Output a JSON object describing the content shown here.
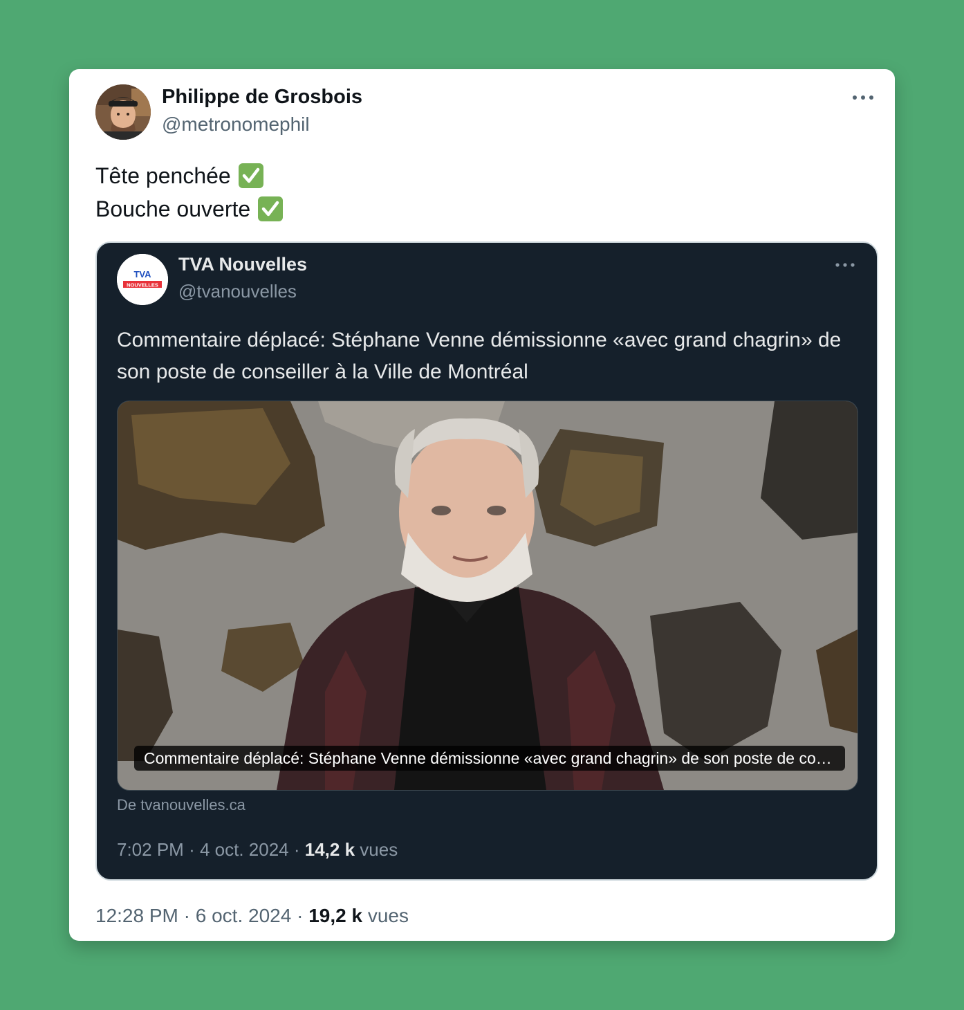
{
  "tweet": {
    "author_name": "Philippe de Grosbois",
    "author_handle": "@metronomephil",
    "text_lines": [
      "Tête penchée",
      "Bouche ouverte"
    ],
    "time": "12:28 PM",
    "separator": "·",
    "date": "6 oct. 2024",
    "views_count": "19,2 k",
    "views_label": "vues"
  },
  "quoted": {
    "author_name": "TVA Nouvelles",
    "author_handle": "@tvanouvelles",
    "logo_text_top": "TVA",
    "logo_text_bottom": "NOUVELLES",
    "headline": "Commentaire déplacé: Stéphane Venne démissionne «avec grand chagrin» de son poste de conseiller à la Ville de Montréal",
    "media_caption": "Commentaire déplacé: Stéphane Venne démissionne «avec grand chagrin» de son poste de conseiller à la Ville de Montréal",
    "source": "De tvanouvelles.ca",
    "time": "7:02 PM",
    "separator": "·",
    "date": "4 oct. 2024",
    "views_count": "14,2 k",
    "views_label": "vues"
  },
  "icons": {
    "more": "more-dots-icon",
    "check": "check-mark-emoji-icon"
  },
  "colors": {
    "background": "#4fa872",
    "card": "#ffffff",
    "quote_bg": "#15202b",
    "check_green": "#77b255",
    "muted_text": "#536471"
  }
}
